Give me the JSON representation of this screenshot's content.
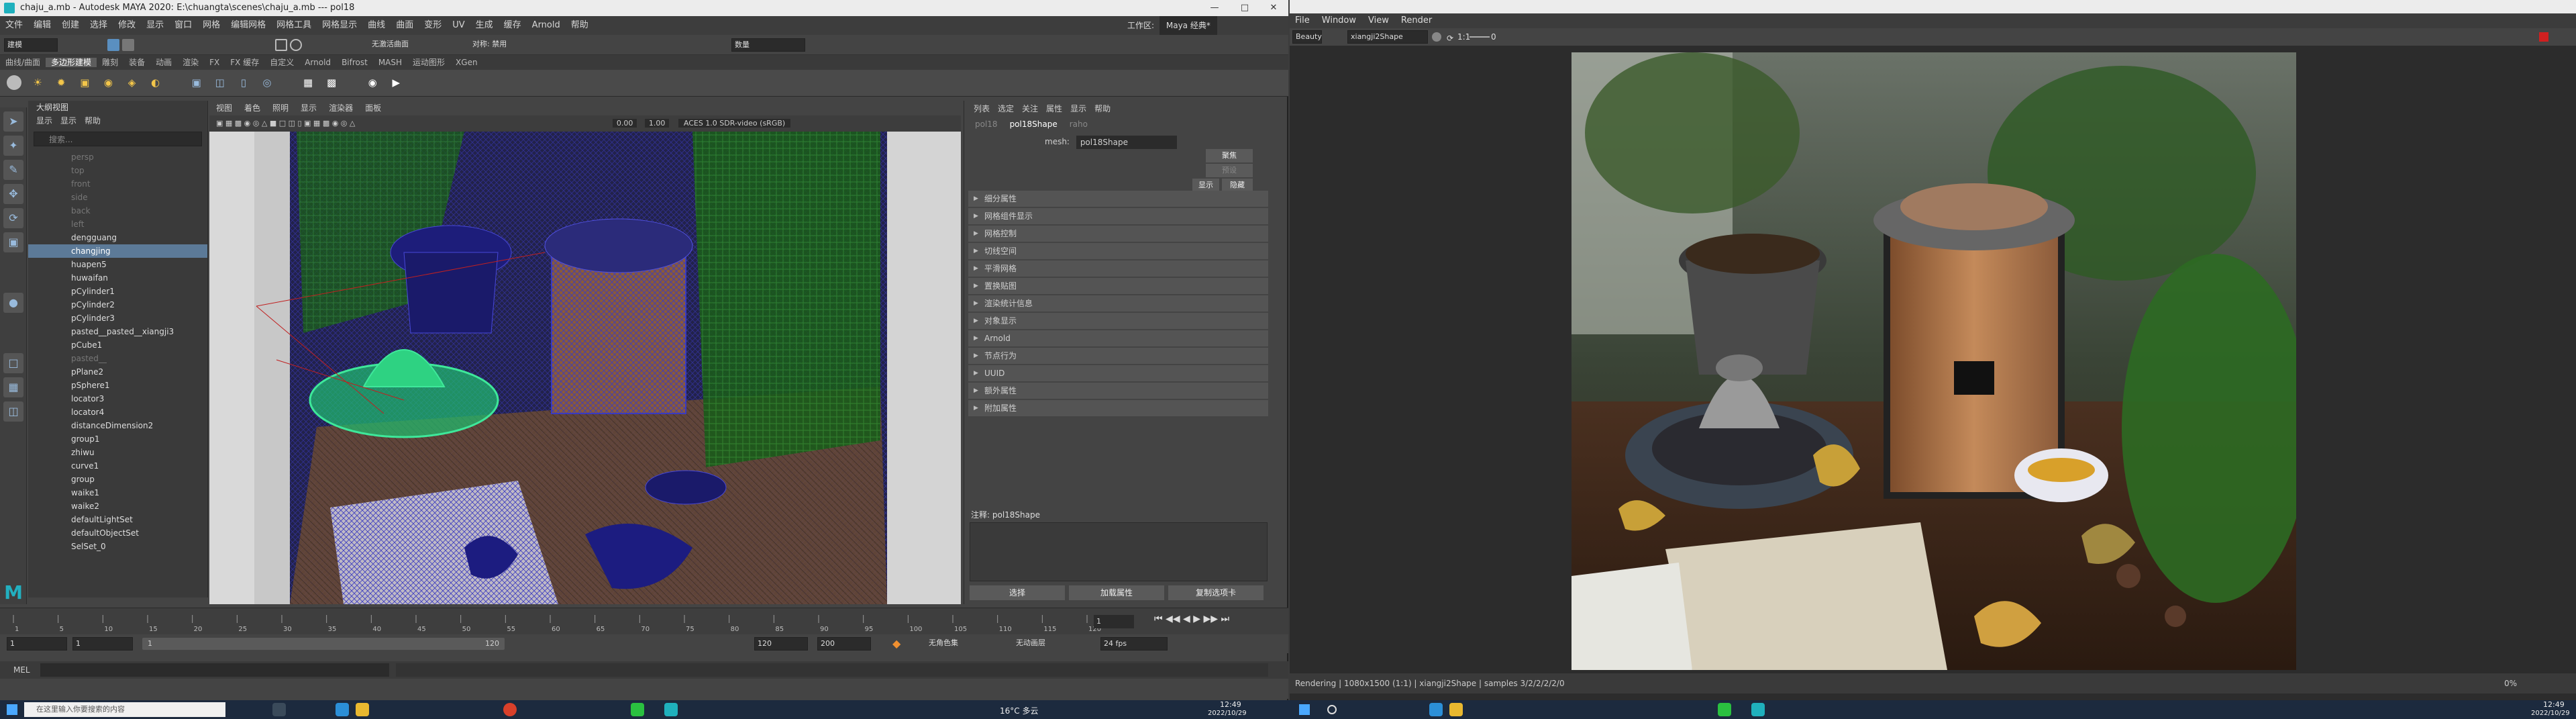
{
  "maya": {
    "title": "chaju_a.mb - Autodesk MAYA 2020: E:\\chuangta\\scenes\\chaju_a.mb  ---  pol18",
    "menus": [
      "文件",
      "编辑",
      "创建",
      "选择",
      "修改",
      "显示",
      "窗口",
      "网格",
      "编辑网格",
      "网格工具",
      "网格显示",
      "曲线",
      "曲面",
      "变形",
      "UV",
      "生成",
      "缓存",
      "Arnold",
      "帮助"
    ],
    "workspace_label": "工作区:",
    "workspace_value": "Maya 经典*",
    "mode_select": "建模",
    "selection_field": "无激活曲面",
    "live_label": "对称: 禁用",
    "status_dropdown": "数量",
    "shelf_tabs": [
      "曲线/曲面",
      "多边形建模",
      "雕刻",
      "装备",
      "动画",
      "渲染",
      "FX",
      "FX 缓存",
      "自定义",
      "Arnold",
      "Bifrost",
      "MASH",
      "运动图形",
      "XGen"
    ],
    "shelf_active": 1,
    "outliner": {
      "title": "大纲视图",
      "menus": [
        "显示",
        "显示",
        "帮助"
      ],
      "search_placeholder": "搜索...",
      "items": [
        {
          "label": "persp",
          "state": "dim"
        },
        {
          "label": "top",
          "state": "dim"
        },
        {
          "label": "front",
          "state": "dim"
        },
        {
          "label": "side",
          "state": "dim"
        },
        {
          "label": "back",
          "state": "dim"
        },
        {
          "label": "left",
          "state": "dim"
        },
        {
          "label": "dengguang",
          "state": ""
        },
        {
          "label": "changjing",
          "state": "sel"
        },
        {
          "label": "huapen5",
          "state": ""
        },
        {
          "label": "huwaifan",
          "state": ""
        },
        {
          "label": "pCylinder1",
          "state": ""
        },
        {
          "label": "pCylinder2",
          "state": ""
        },
        {
          "label": "pCylinder3",
          "state": ""
        },
        {
          "label": "pasted__pasted__xiangji3",
          "state": ""
        },
        {
          "label": "pCube1",
          "state": ""
        },
        {
          "label": "pasted__",
          "state": "dim"
        },
        {
          "label": "pPlane2",
          "state": ""
        },
        {
          "label": "pSphere1",
          "state": ""
        },
        {
          "label": "locator3",
          "state": ""
        },
        {
          "label": "locator4",
          "state": ""
        },
        {
          "label": "distanceDimension2",
          "state": ""
        },
        {
          "label": "group1",
          "state": ""
        },
        {
          "label": "zhiwu",
          "state": ""
        },
        {
          "label": "curve1",
          "state": ""
        },
        {
          "label": "group",
          "state": ""
        },
        {
          "label": "waike1",
          "state": ""
        },
        {
          "label": "waike2",
          "state": ""
        },
        {
          "label": "defaultLightSet",
          "state": ""
        },
        {
          "label": "defaultObjectSet",
          "state": ""
        },
        {
          "label": "SelSet_0",
          "state": ""
        }
      ]
    },
    "viewport": {
      "menus": [
        "视图",
        "着色",
        "照明",
        "显示",
        "渲染器",
        "面板"
      ],
      "gamma_a": "0.00",
      "gamma_b": "1.00",
      "colorspace": "ACES 1.0 SDR-video (sRGB)"
    },
    "attr": {
      "menus": [
        "列表",
        "选定",
        "关注",
        "属性",
        "显示",
        "帮助"
      ],
      "tabs": [
        "pol18",
        "pol18Shape",
        "raho"
      ],
      "active_tab": 1,
      "mesh_label": "mesh:",
      "mesh_value": "pol18Shape",
      "btn_focus": "聚焦",
      "btn_preset": "预设",
      "btn_show": "显示",
      "btn_hide": "隐藏",
      "sections": [
        "细分属性",
        "网格组件显示",
        "网格控制",
        "切线空间",
        "平滑网格",
        "置换贴图",
        "渲染统计信息",
        "对象显示",
        "Arnold",
        "节点行为",
        "UUID",
        "额外属性",
        "附加属性"
      ],
      "notes_label": "注释: pol18Shape",
      "buttons": [
        "选择",
        "加载属性",
        "复制选项卡"
      ]
    },
    "timeline": {
      "start": "1",
      "end": "1",
      "range_start": "1",
      "range_end": "120",
      "anim_end": "200",
      "current": "120",
      "fps": "24 fps",
      "char_set": "无角色集",
      "anim_layer": "无动画层",
      "ticks": [
        "1",
        "5",
        "10",
        "15",
        "20",
        "25",
        "30",
        "35",
        "40",
        "45",
        "50",
        "55",
        "60",
        "65",
        "70",
        "75",
        "80",
        "85",
        "90",
        "95",
        "100",
        "105",
        "110",
        "115",
        "120"
      ],
      "frame_display": "1"
    },
    "cmd_label": "MEL"
  },
  "render": {
    "menus": [
      "File",
      "Window",
      "View",
      "Render"
    ],
    "pass_select": "Beauty",
    "camera_select": "xiangji2Shape",
    "zoom": "1:1",
    "exposure": "0",
    "status": "Rendering | 1080x1500 (1:1) | xiangji2Shape | samples 3/2/2/2/2/0",
    "zoom_pct": "0%"
  },
  "taskbar": {
    "search_placeholder": "在这里输入你要搜索的内容",
    "weather": "16°C 多云",
    "time_left": "12:49",
    "date_left": "2022/10/29",
    "time_right": "12:49",
    "date_right": "2022/10/29"
  },
  "colors": {
    "selection": "#5c7a98",
    "wire": "#1a1a8a",
    "highlight": "#3ee89a",
    "accent_maya": "#22b0c0"
  }
}
